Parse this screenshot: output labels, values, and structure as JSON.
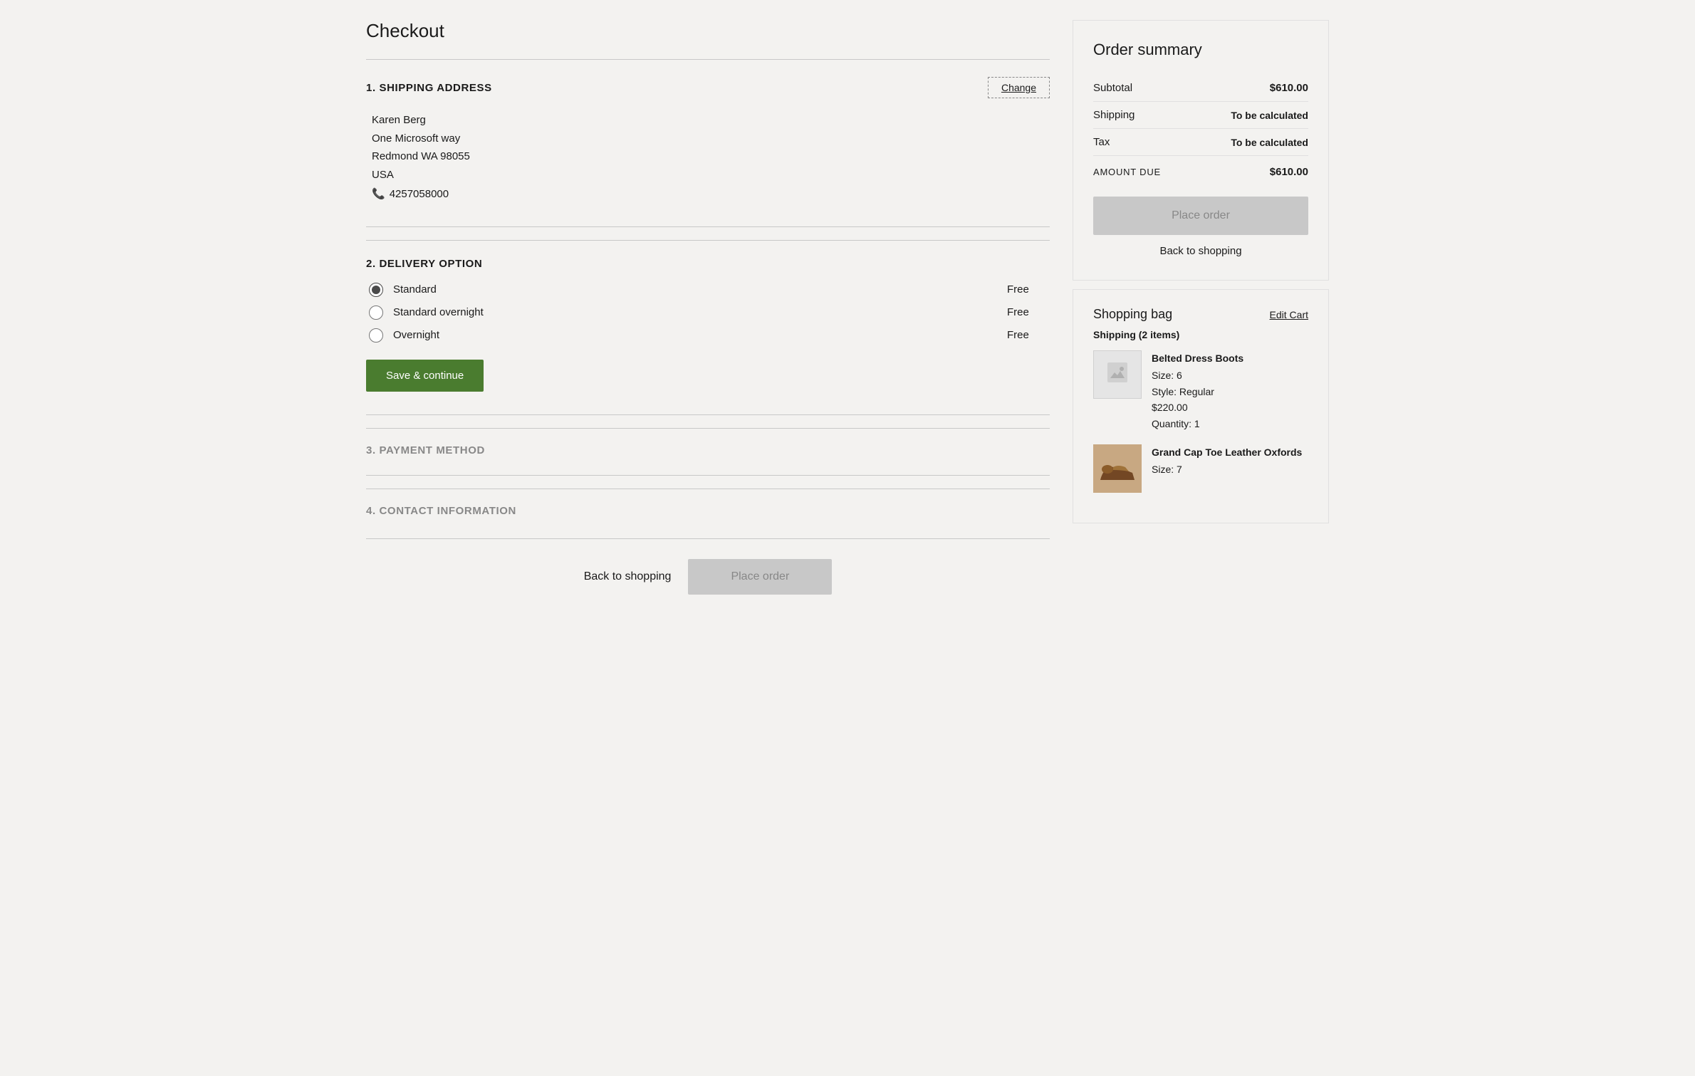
{
  "page": {
    "title": "Checkout"
  },
  "sections": {
    "shipping": {
      "number": "1.",
      "title": "SHIPPING ADDRESS",
      "change_label": "Change",
      "address": {
        "name": "Karen Berg",
        "line1": "One Microsoft way",
        "line2": "Redmond WA  98055",
        "country": "USA",
        "phone": "4257058000"
      }
    },
    "delivery": {
      "number": "2.",
      "title": "DELIVERY OPTION",
      "options": [
        {
          "id": "standard",
          "label": "Standard",
          "price": "Free",
          "selected": true
        },
        {
          "id": "standard-overnight",
          "label": "Standard overnight",
          "price": "Free",
          "selected": false
        },
        {
          "id": "overnight",
          "label": "Overnight",
          "price": "Free",
          "selected": false
        }
      ],
      "save_label": "Save & continue"
    },
    "payment": {
      "number": "3.",
      "title": "PAYMENT METHOD"
    },
    "contact": {
      "number": "4.",
      "title": "CONTACT INFORMATION"
    }
  },
  "bottom_actions": {
    "back_label": "Back to shopping",
    "place_order_label": "Place order"
  },
  "sidebar": {
    "order_summary": {
      "title": "Order summary",
      "rows": [
        {
          "label": "Subtotal",
          "value": "$610.00",
          "bold": true
        },
        {
          "label": "Shipping",
          "value": "To be calculated",
          "light": true
        },
        {
          "label": "Tax",
          "value": "To be calculated",
          "light": true
        }
      ],
      "amount_due_label": "AMOUNT DUE",
      "amount_due_value": "$610.00",
      "place_order_label": "Place order",
      "back_label": "Back to shopping"
    },
    "shopping_bag": {
      "title": "Shopping bag",
      "edit_cart_label": "Edit Cart",
      "section_label": "Shipping (2 items)",
      "items": [
        {
          "name": "Belted Dress Boots",
          "size": "Size: 6",
          "style": "Style: Regular",
          "price": "$220.00",
          "quantity": "Quantity: 1",
          "has_image": false
        },
        {
          "name": "Grand Cap Toe Leather Oxfords",
          "size": "Size: 7",
          "has_image": true
        }
      ]
    }
  },
  "icons": {
    "phone": "📞",
    "image_placeholder": "🖼"
  }
}
